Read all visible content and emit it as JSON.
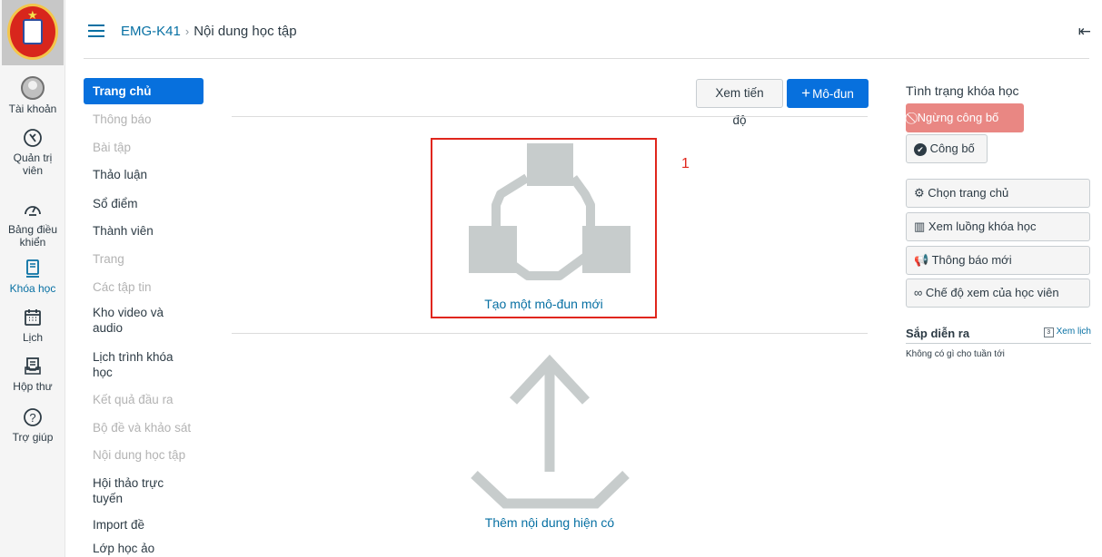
{
  "global_nav": {
    "items": [
      {
        "label": "Tài khoản",
        "icon": "user-avatar-icon"
      },
      {
        "label": "Quản trị viên",
        "icon": "shield-icon"
      },
      {
        "label": "Bảng điều khiển",
        "icon": "dashboard-icon"
      },
      {
        "label": "Khóa học",
        "icon": "book-icon",
        "active": true
      },
      {
        "label": "Lịch",
        "icon": "calendar-icon"
      },
      {
        "label": "Hộp thư",
        "icon": "inbox-icon"
      },
      {
        "label": "Trợ giúp",
        "icon": "help-icon"
      }
    ]
  },
  "header": {
    "course": "EMG-K41",
    "separator": "›",
    "page": "Nội dung học tập"
  },
  "course_nav": {
    "items": [
      {
        "label": "Trang chủ",
        "state": "active"
      },
      {
        "label": "Thông báo",
        "state": "disabled"
      },
      {
        "label": "Bài tập",
        "state": "disabled"
      },
      {
        "label": "Thảo luận",
        "state": "enabled"
      },
      {
        "label": "Sổ điểm",
        "state": "enabled"
      },
      {
        "label": "Thành viên",
        "state": "enabled"
      },
      {
        "label": "Trang",
        "state": "disabled"
      },
      {
        "label": "Các tập tin",
        "state": "disabled"
      },
      {
        "label": "Kho video và audio",
        "state": "enabled"
      },
      {
        "label": "Lịch trình khóa học",
        "state": "enabled"
      },
      {
        "label": "Kết quả đầu ra",
        "state": "disabled"
      },
      {
        "label": "Bộ đề và khảo sát",
        "state": "disabled"
      },
      {
        "label": "Nội dung học tập",
        "state": "disabled"
      },
      {
        "label": "Hội thảo trực tuyến",
        "state": "enabled"
      },
      {
        "label": "Import đề",
        "state": "enabled"
      },
      {
        "label": "Lớp học ảo ClassIn",
        "state": "enabled"
      }
    ]
  },
  "toolbar": {
    "progress_label": "Xem tiến độ",
    "add_module_label": "Mô-đun",
    "add_module_icon": "plus-icon"
  },
  "main": {
    "create_module_label": "Tạo một mô-đun mới",
    "annotation_marker": "1",
    "import_content_label": "Thêm nội dung hiện có"
  },
  "sidebar": {
    "status_title": "Tình trạng khóa học",
    "unpublish_label": "Ngừng công bố",
    "publish_label": "Công bố",
    "actions": [
      {
        "label": "Chọn trang chủ",
        "icon": "gear-icon"
      },
      {
        "label": "Xem luồng khóa học",
        "icon": "stream-icon"
      },
      {
        "label": "Thông báo mới",
        "icon": "megaphone-icon"
      },
      {
        "label": "Chế độ xem của học viên",
        "icon": "glasses-icon"
      }
    ],
    "upcoming_title": "Sắp diễn ra",
    "upcoming_link": "Xem lịch",
    "upcoming_empty": "Không có gì cho tuần tới"
  },
  "colors": {
    "accent": "#0770dd",
    "link": "#0770a3",
    "highlight_box": "#e0261c",
    "unpublish": "#e98783",
    "illustration": "#c7cccc"
  }
}
